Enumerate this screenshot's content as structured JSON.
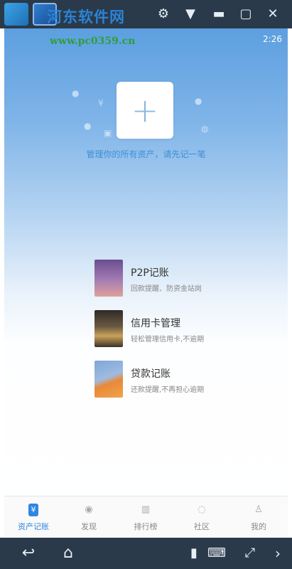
{
  "window": {
    "watermark_title": "河东软件网",
    "watermark_url": "www.pc0359.cn",
    "controls": [
      "gear-icon",
      "menu-icon",
      "minimize-icon",
      "maximize-icon",
      "close-icon"
    ]
  },
  "status": {
    "time": "2:26"
  },
  "hero": {
    "add_symbol": "+",
    "hint": "管理你的所有资产，请先记一笔"
  },
  "features": [
    {
      "title": "P2P记账",
      "subtitle": "回款提醒、防资金站岗"
    },
    {
      "title": "信用卡管理",
      "subtitle": "轻松管理信用卡,不逾期"
    },
    {
      "title": "贷款记账",
      "subtitle": "还款提醒,不再担心逾期"
    }
  ],
  "tabs": [
    {
      "label": "资产记账",
      "icon": "¥",
      "active": true
    },
    {
      "label": "发现",
      "icon": "◉",
      "active": false
    },
    {
      "label": "排行榜",
      "icon": "▥",
      "active": false
    },
    {
      "label": "社区",
      "icon": "◌",
      "active": false
    },
    {
      "label": "我的",
      "icon": "♙",
      "active": false
    }
  ],
  "colors": {
    "accent": "#2f86e0",
    "hint": "#3f8fd6",
    "titlebar": "#2a3a4a"
  }
}
